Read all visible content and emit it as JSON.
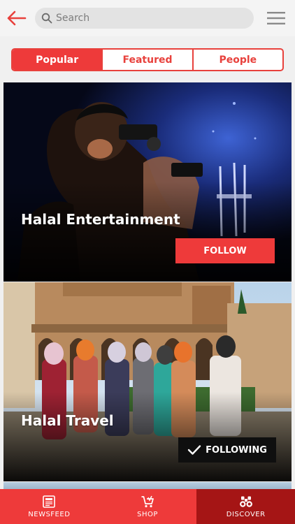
{
  "header": {
    "search_placeholder": "Search"
  },
  "tabs": [
    {
      "label": "Popular",
      "active": true
    },
    {
      "label": "Featured",
      "active": false
    },
    {
      "label": "People",
      "active": false
    }
  ],
  "cards": [
    {
      "title": "Halal Entertainment",
      "action_label": "FOLLOW",
      "following": false
    },
    {
      "title": "Halal Travel",
      "action_label": "FOLLOWING",
      "following": true
    }
  ],
  "bottom_nav": [
    {
      "label": "NEWSFEED",
      "icon": "newspaper-icon",
      "active": false
    },
    {
      "label": "SHOP",
      "icon": "cart-icon",
      "active": false
    },
    {
      "label": "DISCOVER",
      "icon": "binoculars-icon",
      "active": true
    }
  ],
  "colors": {
    "accent": "#ee3a3a",
    "accent_dark": "#a51515"
  }
}
